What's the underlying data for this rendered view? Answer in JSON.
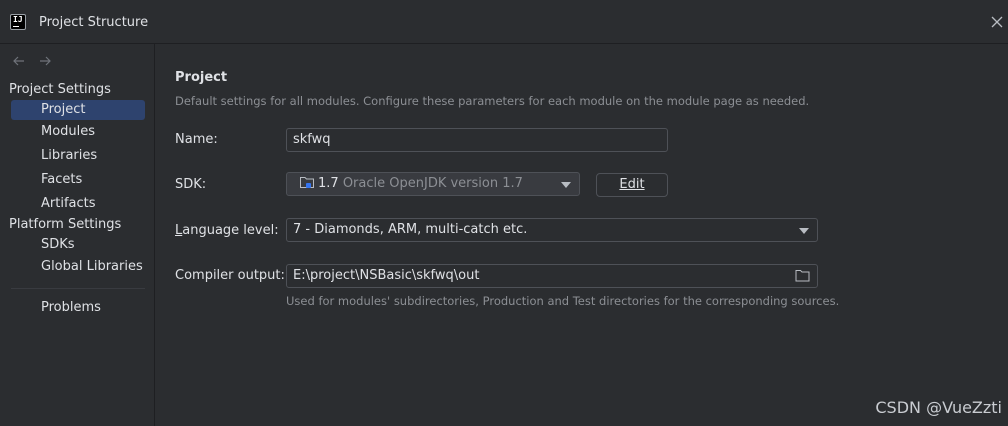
{
  "window": {
    "title": "Project Structure"
  },
  "sidebar": {
    "project_settings_label": "Project Settings",
    "project_items": [
      "Project",
      "Modules",
      "Libraries",
      "Facets",
      "Artifacts"
    ],
    "platform_settings_label": "Platform Settings",
    "platform_items": [
      "SDKs",
      "Global Libraries"
    ],
    "problems_label": "Problems",
    "selected": "Project"
  },
  "main": {
    "heading": "Project",
    "description": "Default settings for all modules. Configure these parameters for each module on the module page as needed.",
    "name_label": "Name:",
    "name_value": "skfwq",
    "sdk_label": "SDK:",
    "sdk_version": "1.7",
    "sdk_name": "Oracle OpenJDK version 1.7",
    "edit_label": "Edit",
    "language_label_prefix": "L",
    "language_label_rest": "anguage level:",
    "language_value": "7 - Diamonds, ARM, multi-catch etc.",
    "compiler_label": "Compiler output:",
    "compiler_value": "E:\\project\\NSBasic\\skfwq\\out",
    "compiler_hint": "Used for modules' subdirectories, Production and Test directories for the corresponding sources."
  },
  "watermark": "CSDN @VueZzti",
  "colors": {
    "selected_bg": "#2e436e",
    "background": "#2b2d30",
    "accent_icon": "#3574f0"
  }
}
